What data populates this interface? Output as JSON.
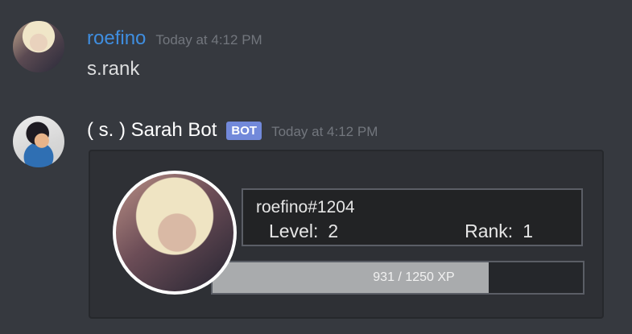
{
  "messages": {
    "user": {
      "username": "roefino",
      "timestamp": "Today at 4:12 PM",
      "content": "s.rank"
    },
    "bot": {
      "username": "( s. ) Sarah Bot",
      "bot_tag": "BOT",
      "timestamp": "Today at 4:12 PM"
    }
  },
  "rank_card": {
    "tag": "roefino#1204",
    "level_label": "Level:",
    "level_value": "2",
    "rank_label": "Rank:",
    "rank_value": "1",
    "xp_text": "931 / 1250 XP",
    "xp_current": 931,
    "xp_total": 1250
  },
  "colors": {
    "background": "#36393f",
    "username_user": "#3f8ee0",
    "bot_tag": "#7289da",
    "timestamp": "#72767d"
  }
}
